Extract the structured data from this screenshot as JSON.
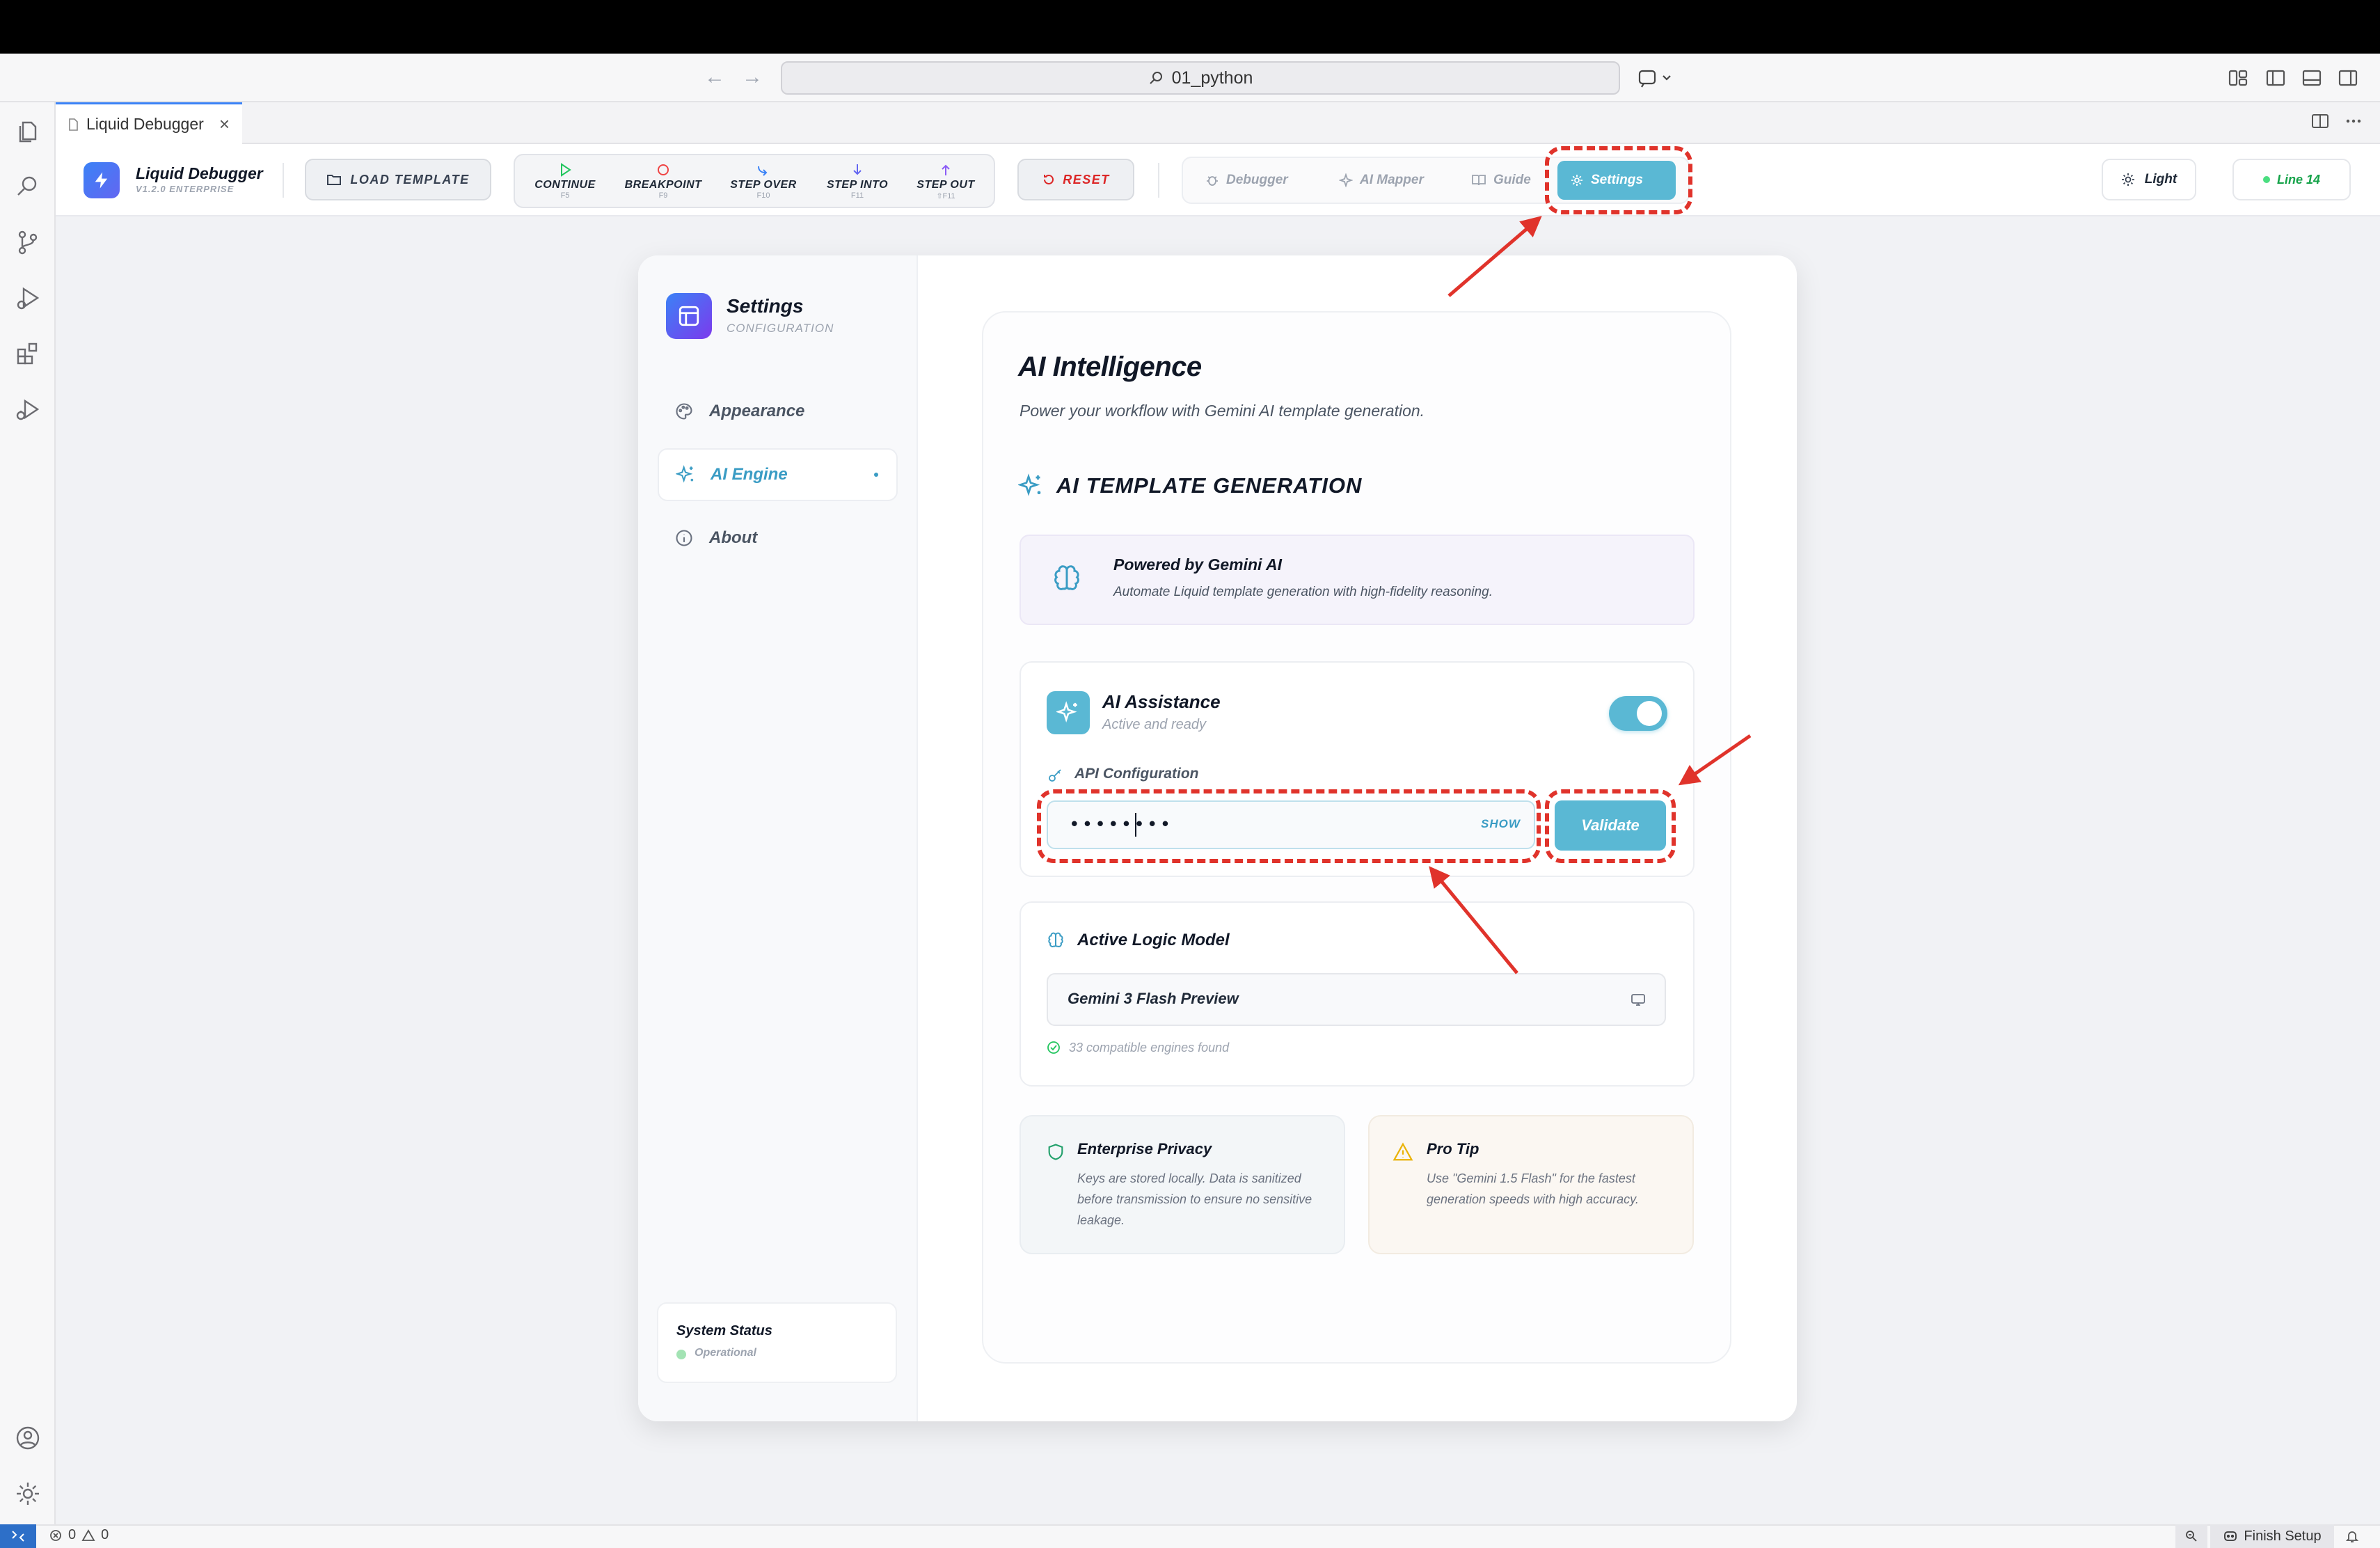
{
  "window": {
    "search_text": "01_python"
  },
  "editor": {
    "tab_label": "Liquid Debugger",
    "tab_close": "×"
  },
  "app": {
    "brand_name": "Liquid Debugger",
    "brand_version": "V1.2.0 ENTERPRISE",
    "load_template": "LOAD TEMPLATE",
    "debug_controls": [
      {
        "label": "CONTINUE",
        "key": "F5"
      },
      {
        "label": "BREAKPOINT",
        "key": "F9"
      },
      {
        "label": "STEP OVER",
        "key": "F10"
      },
      {
        "label": "STEP INTO",
        "key": "F11"
      },
      {
        "label": "STEP OUT",
        "key": "⇧F11"
      }
    ],
    "reset": "RESET",
    "nav_tabs": [
      "Debugger",
      "AI Mapper",
      "Guide",
      "Settings"
    ],
    "theme_label": "Light",
    "line_badge": "Line 14"
  },
  "settings": {
    "title": "Settings",
    "subtitle": "CONFIGURATION",
    "menu": [
      "Appearance",
      "AI Engine",
      "About"
    ],
    "system_status_title": "System Status",
    "system_status_value": "Operational"
  },
  "ai": {
    "heading": "AI Intelligence",
    "description": "Power your workflow with Gemini AI template generation.",
    "section_title": "AI TEMPLATE GENERATION",
    "gemini_title": "Powered by Gemini AI",
    "gemini_desc": "Automate Liquid template generation with high-fidelity reasoning.",
    "assist_title": "AI Assistance",
    "assist_status": "Active and ready",
    "assist_enabled": true,
    "api_label": "API Configuration",
    "api_value": "••••••••",
    "show_label": "SHOW",
    "validate_label": "Validate",
    "model_title": "Active Logic Model",
    "model_value": "Gemini 3 Flash Preview",
    "engines_found": "33 compatible engines found",
    "privacy_title": "Enterprise Privacy",
    "privacy_desc": "Keys are stored locally. Data is sanitized before transmission to ensure no sensitive leakage.",
    "tip_title": "Pro Tip",
    "tip_desc": "Use \"Gemini 1.5 Flash\" for the fastest generation speeds with high accuracy."
  },
  "status_bar": {
    "errors": "0",
    "warnings": "0",
    "finish_setup": "Finish Setup"
  },
  "colors": {
    "accent": "#5ab8d4",
    "annotation": "#e0332b",
    "reset": "#dc2626",
    "status_green": "#16a34a"
  }
}
